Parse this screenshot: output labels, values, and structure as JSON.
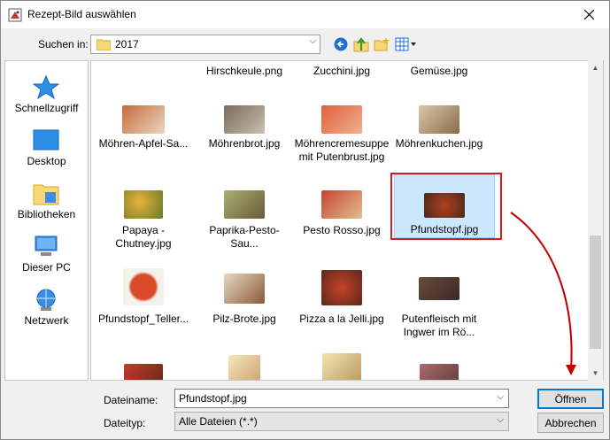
{
  "window": {
    "title": "Rezept-Bild auswählen"
  },
  "toolbar": {
    "lookin_label": "Suchen in:",
    "lookin_value": "2017"
  },
  "sidebar": {
    "items": [
      {
        "label": "Schnellzugriff",
        "icon": "star-icon"
      },
      {
        "label": "Desktop",
        "icon": "desktop-icon"
      },
      {
        "label": "Bibliotheken",
        "icon": "libraries-icon"
      },
      {
        "label": "Dieser PC",
        "icon": "pc-icon"
      },
      {
        "label": "Netzwerk",
        "icon": "network-icon"
      }
    ]
  },
  "files": {
    "row0": [
      "Hirschkeule.png",
      "Zucchini.jpg",
      "Gemüse.jpg"
    ],
    "row1": [
      "Möhren-Apfel-Sa...",
      "Möhrenbrot.jpg",
      "Möhrencremesuppe\nmit Putenbrust.jpg",
      "Möhrenkuchen.jpg"
    ],
    "row2": [
      "Papaya -\nChutney.jpg",
      "Paprika-Pesto-Sau...",
      "Pesto Rosso.jpg",
      "Pfundstopf.jpg"
    ],
    "row3": [
      "Pfundstopf_Teller...",
      "Pilz-Brote.jpg",
      "Pizza a la Jelli.jpg",
      "Putenfleisch mit\nIngwer im Rö..."
    ],
    "selected": "Pfundstopf.jpg"
  },
  "bottom": {
    "filename_label": "Dateiname:",
    "filename_value": "Pfundstopf.jpg",
    "filetype_label": "Dateityp:",
    "filetype_value": "Alle Dateien (*.*)",
    "open_label": "Öffnen",
    "cancel_label": "Abbrechen"
  },
  "colors": {
    "selection_bg": "#cce8ff",
    "highlight_frame": "#d0201c",
    "arrow": "#c00000"
  }
}
